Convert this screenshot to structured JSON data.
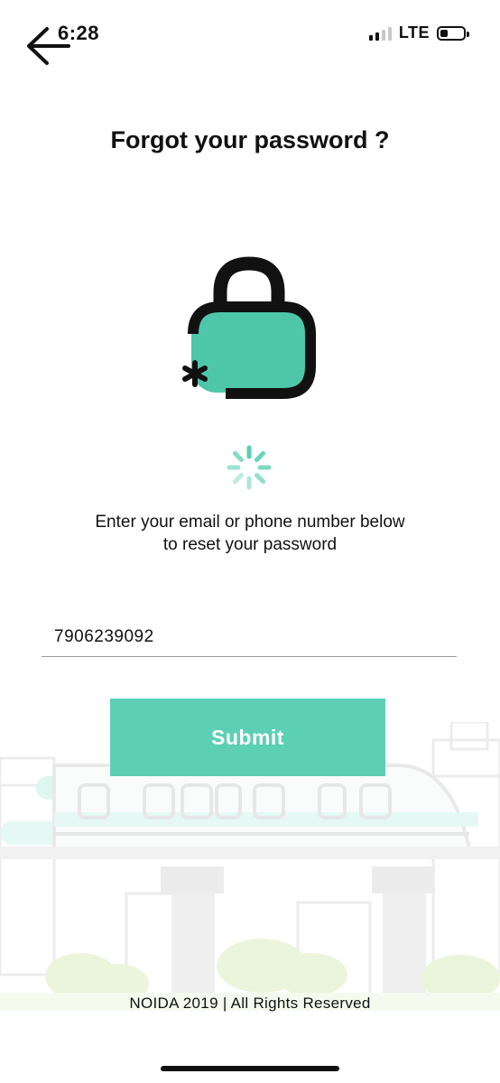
{
  "status_bar": {
    "time": "6:28",
    "network": "LTE",
    "signal_bars_active": 2,
    "signal_bars_total": 4,
    "battery_level": 0.2
  },
  "header": {
    "back_icon": "arrow-left-icon"
  },
  "page": {
    "title": "Forgot your password ?",
    "illustration_icon": "padlock-asterisk-icon",
    "loading_icon": "spinner-icon",
    "instruction_line1": "Enter your email or phone number below",
    "instruction_line2": "to reset your password"
  },
  "form": {
    "contact_value": "7906239092",
    "submit_label": "Submit"
  },
  "footer": {
    "text": "NOIDA 2019 | All Rights Reserved"
  },
  "colors": {
    "accent": "#5ccfb4",
    "text": "#111111",
    "background": "#ffffff"
  }
}
